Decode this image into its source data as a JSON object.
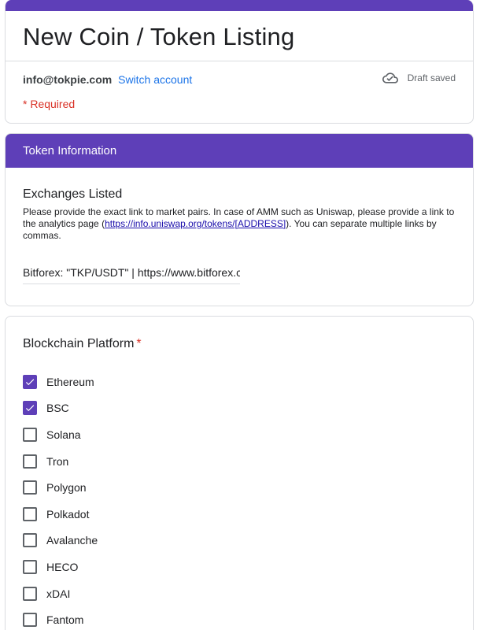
{
  "form": {
    "title": "New Coin / Token Listing",
    "account_email": "info@tokpie.com",
    "switch_account": "Switch account",
    "draft_status": "Draft saved",
    "required_note": "* Required",
    "accent_color": "#5e3fb8"
  },
  "section": {
    "header": "Token Information",
    "question_title": "Exchanges Listed",
    "description_before": "Please provide the exact link to market pairs. In case of AMM such as Uniswap, please provide a link to the analytics page (",
    "description_link": "https://info.uniswap.org/tokens/[ADDRESS]",
    "description_after": "). You can separate multiple links by commas.",
    "answer_value": "Bitforex: \"TKP/USDT\" | https://www.bitforex.com"
  },
  "platform": {
    "title": "Blockchain Platform",
    "required_star": "*",
    "options": [
      {
        "label": "Ethereum",
        "checked": true
      },
      {
        "label": "BSC",
        "checked": true
      },
      {
        "label": "Solana",
        "checked": false
      },
      {
        "label": "Tron",
        "checked": false
      },
      {
        "label": "Polygon",
        "checked": false
      },
      {
        "label": "Polkadot",
        "checked": false
      },
      {
        "label": "Avalanche",
        "checked": false
      },
      {
        "label": "HECO",
        "checked": false
      },
      {
        "label": "xDAI",
        "checked": false
      },
      {
        "label": "Fantom",
        "checked": false
      }
    ]
  }
}
